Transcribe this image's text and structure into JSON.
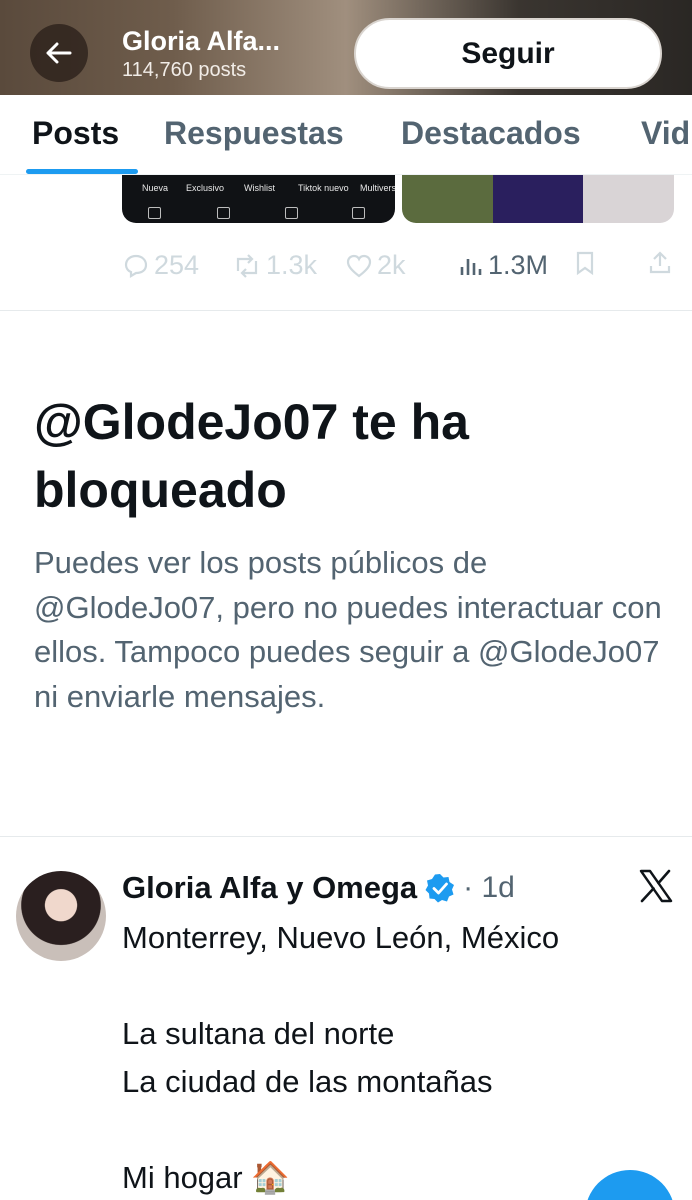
{
  "header": {
    "name": "Gloria Alfa...",
    "posts_count": "114,760 posts",
    "follow_label": "Seguir",
    "back_icon": "arrow-left-icon"
  },
  "tabs": [
    {
      "label": "Posts",
      "active": true
    },
    {
      "label": "Respuestas",
      "active": false
    },
    {
      "label": "Destacados",
      "active": false
    },
    {
      "label": "Vid",
      "active": false
    }
  ],
  "previous_post": {
    "thumbnail_labels": [
      "Nueva",
      "Exclusivo",
      "Wishlist",
      "Tiktok nuevo",
      "Multivers"
    ],
    "actions": {
      "replies": "254",
      "reposts": "1.3k",
      "likes": "2k",
      "views": "1.3M"
    }
  },
  "blocked_notice": {
    "title": "@GlodeJo07 te ha bloqueado",
    "description": "Puedes ver los posts públicos de @GlodeJo07, pero no puedes interactuar con ellos. Tampoco puedes seguir a @GlodeJo07 ni enviarle mensajes."
  },
  "tweet": {
    "author": "Gloria Alfa y Omega",
    "meta": "· 1d",
    "body": "Monterrey, Nuevo León, México\n\nLa sultana del norte\nLa ciudad de las montañas\n\nMi hogar 🏠"
  },
  "colors": {
    "accent": "#1d9bf0",
    "text_primary": "#0f1419",
    "text_secondary": "#536471"
  }
}
